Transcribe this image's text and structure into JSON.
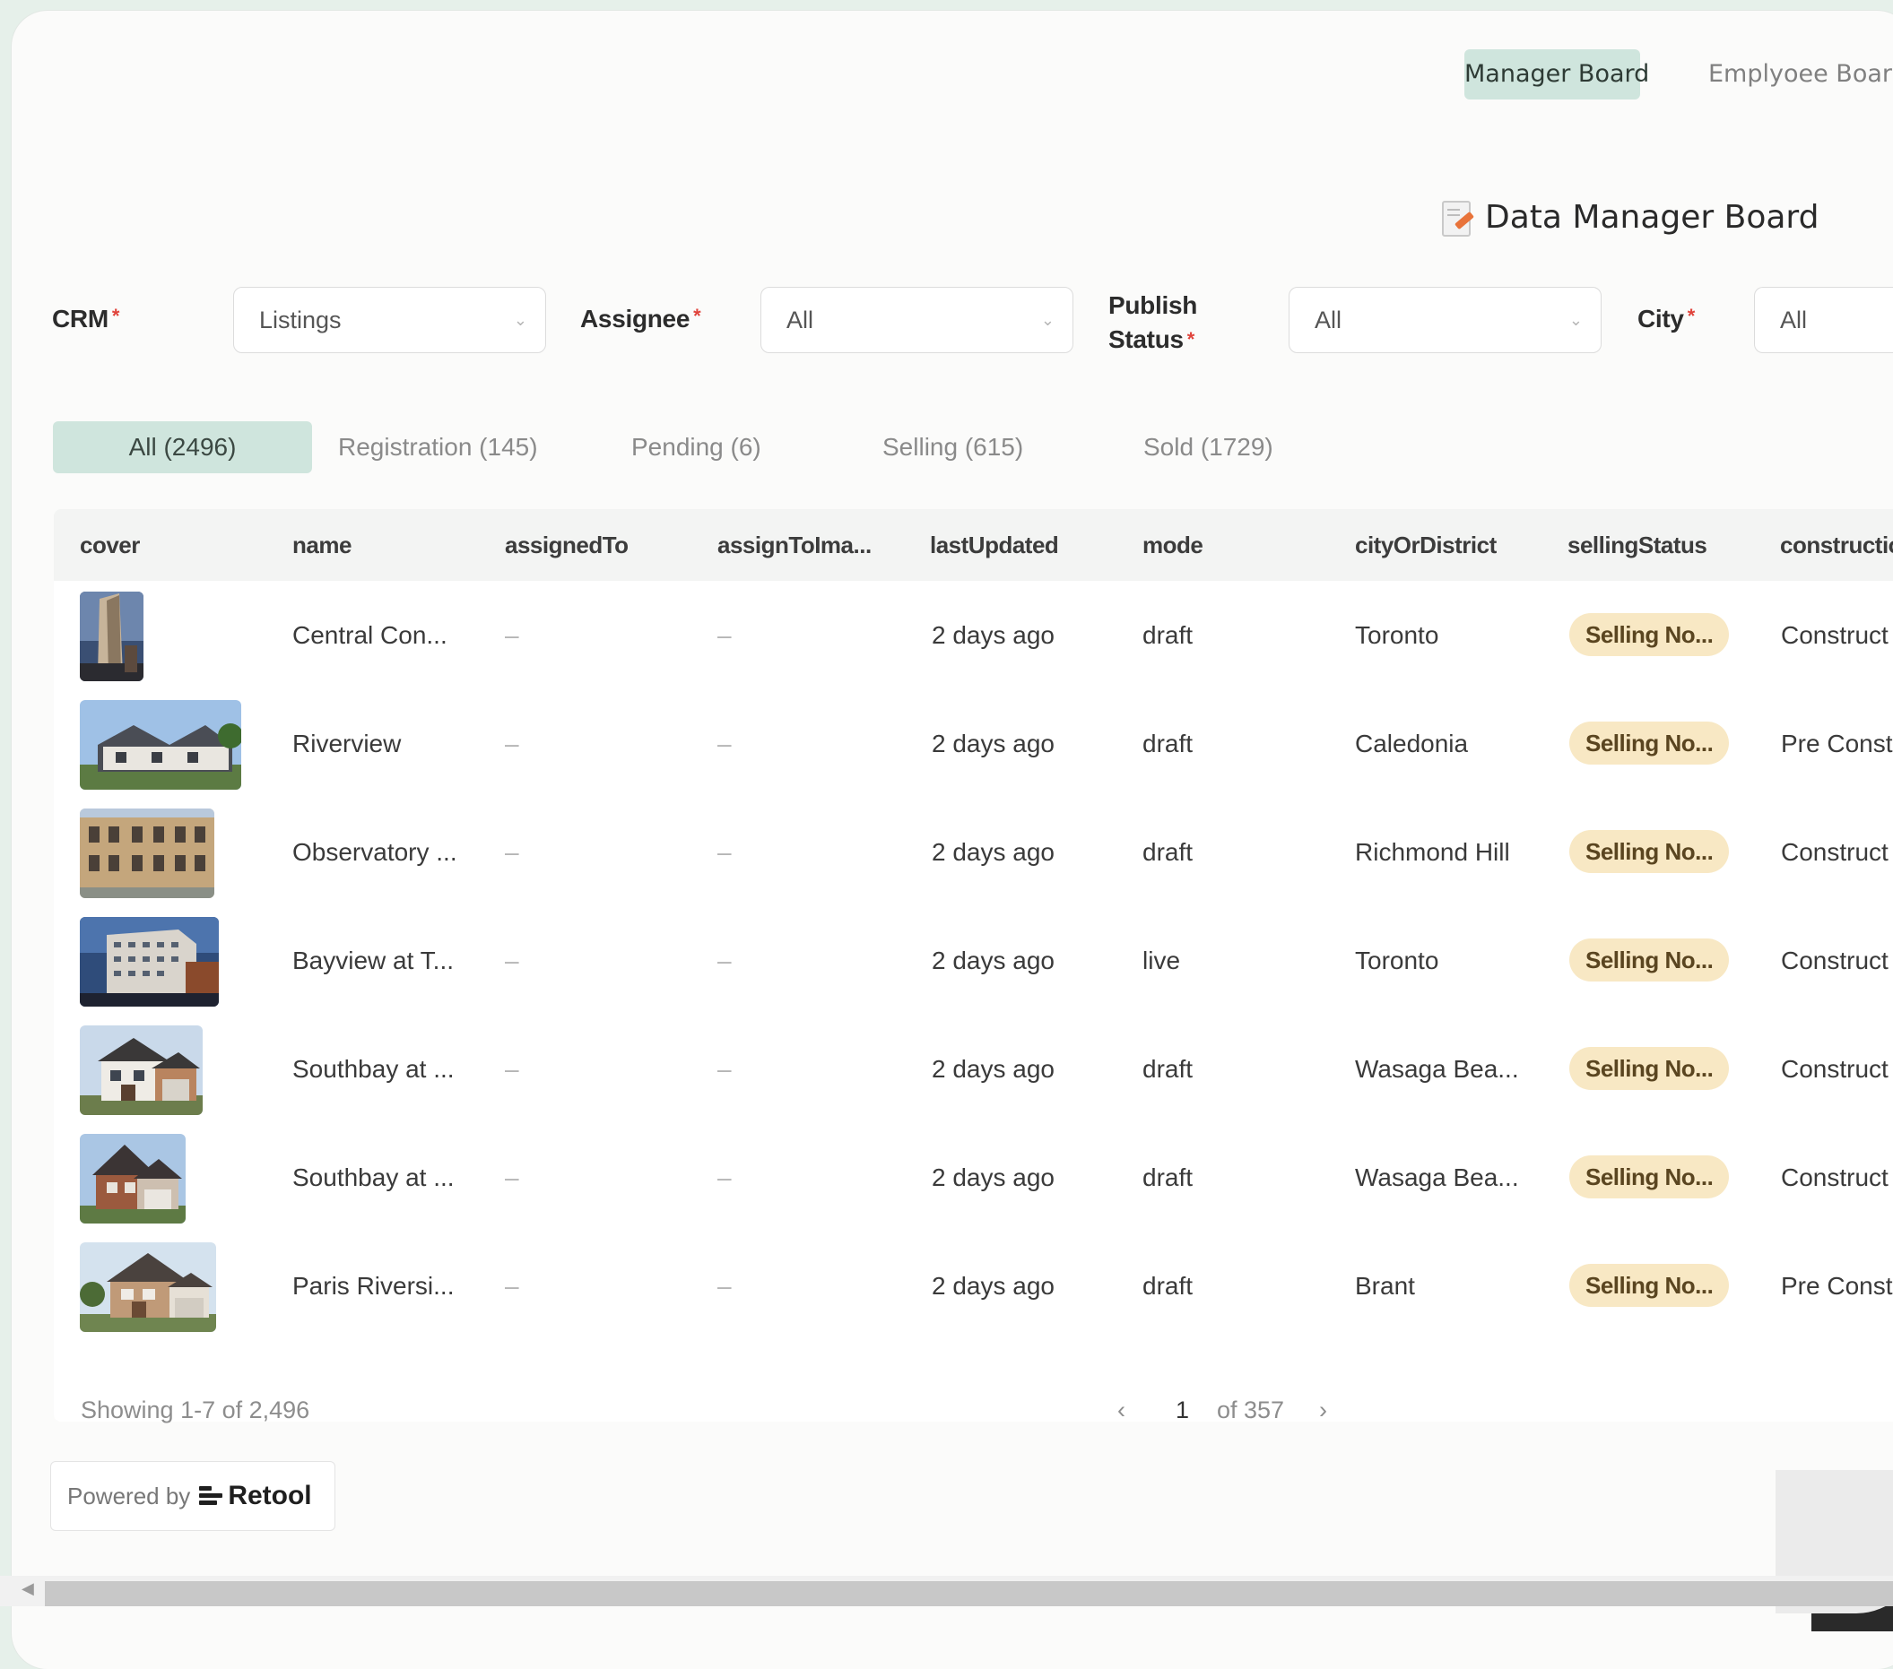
{
  "top_tabs": {
    "manager": "Manager Board",
    "employee": "Emplyoee Board"
  },
  "title": "Data Manager Board",
  "filters": {
    "crm": {
      "label": "CRM",
      "value": "Listings"
    },
    "assignee": {
      "label": "Assignee",
      "value": "All"
    },
    "publish_status": {
      "label_line1": "Publish",
      "label_line2": "Status",
      "value": "All"
    },
    "city": {
      "label": "City",
      "value": "All"
    },
    "required_mark": "*"
  },
  "status_tabs": [
    "All (2496)",
    "Registration (145)",
    "Pending (6)",
    "Selling (615)",
    "Sold (1729)"
  ],
  "columns": [
    "cover",
    "name",
    "assignedTo",
    "assignToIma...",
    "lastUpdated",
    "mode",
    "cityOrDistrict",
    "sellingStatus",
    "constructio"
  ],
  "rows": [
    {
      "name": "Central Con...",
      "assignedTo": "–",
      "assignToIma": "–",
      "lastUpdated": "2 days ago",
      "mode": "draft",
      "city": "Toronto",
      "sellingStatus": "Selling No...",
      "construction": "Construct"
    },
    {
      "name": "Riverview",
      "assignedTo": "–",
      "assignToIma": "–",
      "lastUpdated": "2 days ago",
      "mode": "draft",
      "city": "Caledonia",
      "sellingStatus": "Selling No...",
      "construction": "Pre Const"
    },
    {
      "name": "Observatory ...",
      "assignedTo": "–",
      "assignToIma": "–",
      "lastUpdated": "2 days ago",
      "mode": "draft",
      "city": "Richmond Hill",
      "sellingStatus": "Selling No...",
      "construction": "Construct"
    },
    {
      "name": "Bayview at T...",
      "assignedTo": "–",
      "assignToIma": "–",
      "lastUpdated": "2 days ago",
      "mode": "live",
      "city": "Toronto",
      "sellingStatus": "Selling No...",
      "construction": "Construct"
    },
    {
      "name": "Southbay at ...",
      "assignedTo": "–",
      "assignToIma": "–",
      "lastUpdated": "2 days ago",
      "mode": "draft",
      "city": "Wasaga Bea...",
      "sellingStatus": "Selling No...",
      "construction": "Construct"
    },
    {
      "name": "Southbay at ...",
      "assignedTo": "–",
      "assignToIma": "–",
      "lastUpdated": "2 days ago",
      "mode": "draft",
      "city": "Wasaga Bea...",
      "sellingStatus": "Selling No...",
      "construction": "Construct"
    },
    {
      "name": "Paris Riversi...",
      "assignedTo": "–",
      "assignToIma": "–",
      "lastUpdated": "2 days ago",
      "mode": "draft",
      "city": "Brant",
      "sellingStatus": "Selling No...",
      "construction": "Pre Const"
    }
  ],
  "pagination": {
    "summary": "Showing 1-7 of 2,496",
    "prev": "‹",
    "current": "1",
    "total": "of 357",
    "next": "›"
  },
  "powered": {
    "prefix": "Powered by",
    "brand": "Retool"
  },
  "colors": {
    "accent_tab": "#cfe5dd",
    "badge_bg": "#f8e8c4",
    "required": "#e0433b",
    "background": "#e6f0ea"
  }
}
